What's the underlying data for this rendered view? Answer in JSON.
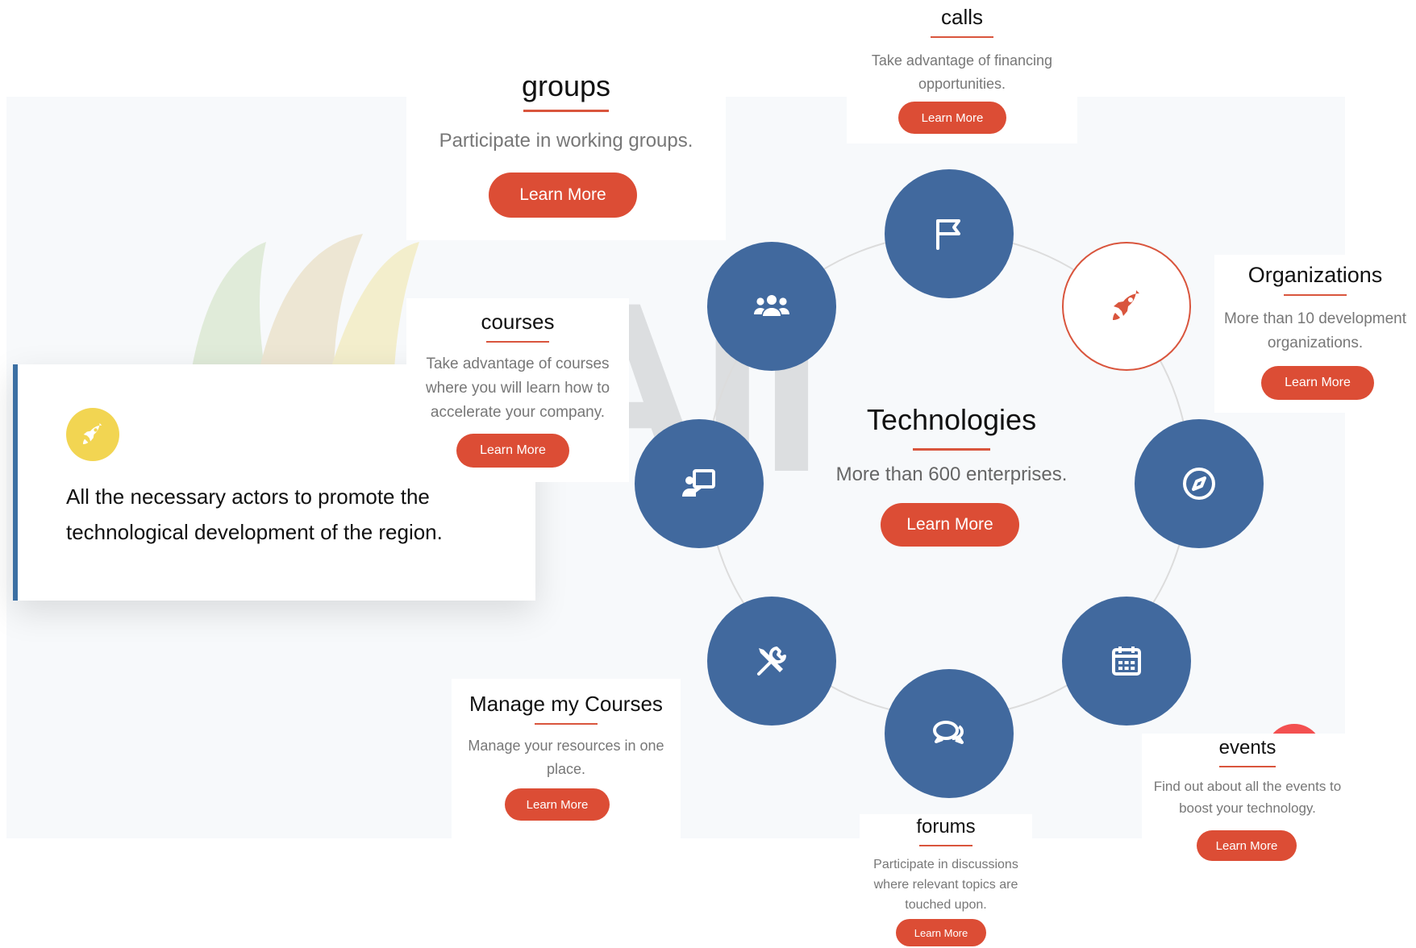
{
  "hero": {
    "text": "All the necessary actors to promote the technological development of the region."
  },
  "center": {
    "title": "Technologies",
    "description": "More than 600 enterprises.",
    "button": "Learn More"
  },
  "cards": {
    "calls": {
      "title": "calls",
      "description": "Take advantage of financing opportunities.",
      "button": "Learn More"
    },
    "groups": {
      "title": "groups",
      "description": "Participate in working groups.",
      "button": "Learn More"
    },
    "organizations": {
      "title": "Organizations",
      "description": "More than 10 development organizations.",
      "button": "Learn More"
    },
    "courses": {
      "title": "courses",
      "description": "Take advantage of courses where you will learn how to accelerate your company.",
      "button": "Learn More"
    },
    "manage_courses": {
      "title": "Manage my Courses",
      "description": "Manage your resources in one place.",
      "button": "Learn More"
    },
    "forums": {
      "title": "forums",
      "description": "Participate in discussions where relevant topics are touched upon.",
      "button": "Learn More"
    },
    "events": {
      "title": "events",
      "description": "Find out about all the events to boost your technology.",
      "button": "Learn More"
    }
  },
  "orbit_nodes": [
    {
      "icon": "flag-icon"
    },
    {
      "icon": "rocket-icon"
    },
    {
      "icon": "compass-icon"
    },
    {
      "icon": "calendar-icon"
    },
    {
      "icon": "chat-bubbles-icon"
    },
    {
      "icon": "tools-icon"
    },
    {
      "icon": "teacher-board-icon"
    },
    {
      "icon": "users-group-icon"
    }
  ],
  "colors": {
    "node_blue": "#41699e",
    "accent_red": "#dc4d35",
    "hero_icon_yellow": "#f2d552",
    "hero_border": "#3b6fa3"
  }
}
